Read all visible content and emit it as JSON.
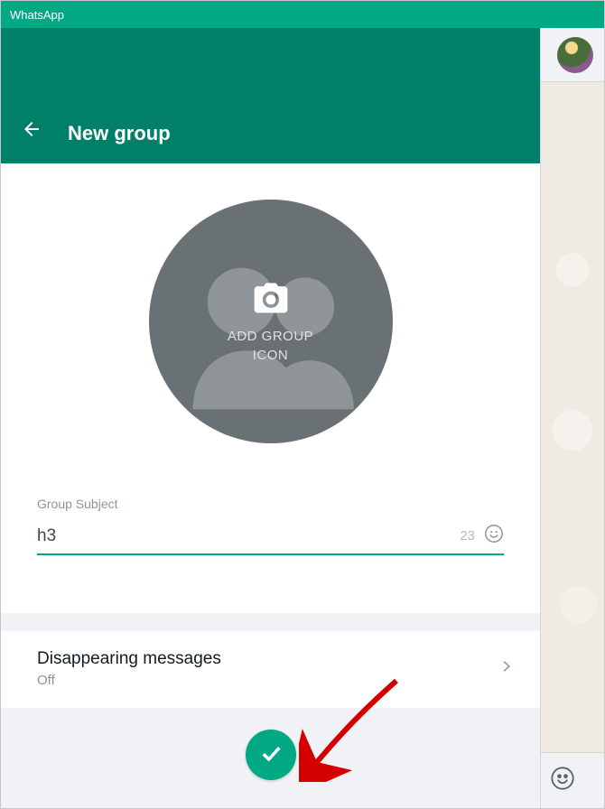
{
  "window": {
    "title": "WhatsApp"
  },
  "panel": {
    "title": "New group",
    "iconPicker": {
      "label_line1": "ADD GROUP",
      "label_line2": "ICON"
    },
    "subject": {
      "label": "Group Subject",
      "value": "h3",
      "remaining": "23"
    },
    "disappearing": {
      "title": "Disappearing messages",
      "value": "Off"
    }
  }
}
